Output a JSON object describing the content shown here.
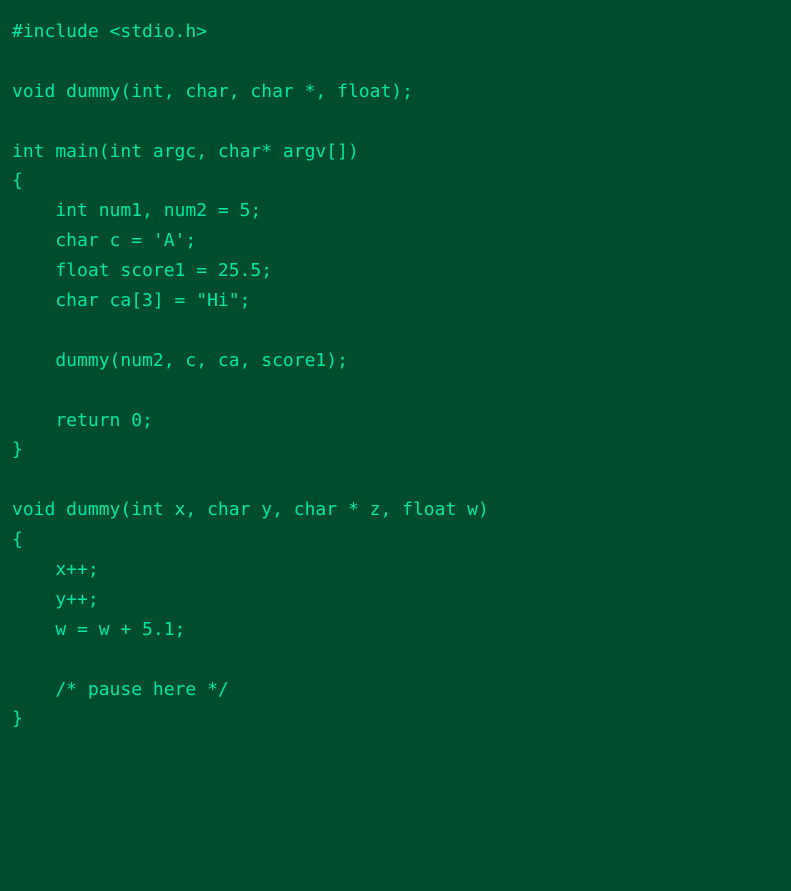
{
  "editor": {
    "background": "#004d2e",
    "text_color": "#00e5a0",
    "lines": [
      "#include <stdio.h>",
      "",
      "void dummy(int, char, char *, float);",
      "",
      "int main(int argc, char* argv[])",
      "{",
      "    int num1, num2 = 5;",
      "    char c = 'A';",
      "    float score1 = 25.5;",
      "    char ca[3] = \"Hi\";",
      "",
      "    dummy(num2, c, ca, score1);",
      "",
      "    return 0;",
      "}",
      "",
      "void dummy(int x, char y, char * z, float w)",
      "{",
      "    x++;",
      "    y++;",
      "    w = w + 5.1;",
      "",
      "    /* pause here */",
      "}"
    ]
  }
}
